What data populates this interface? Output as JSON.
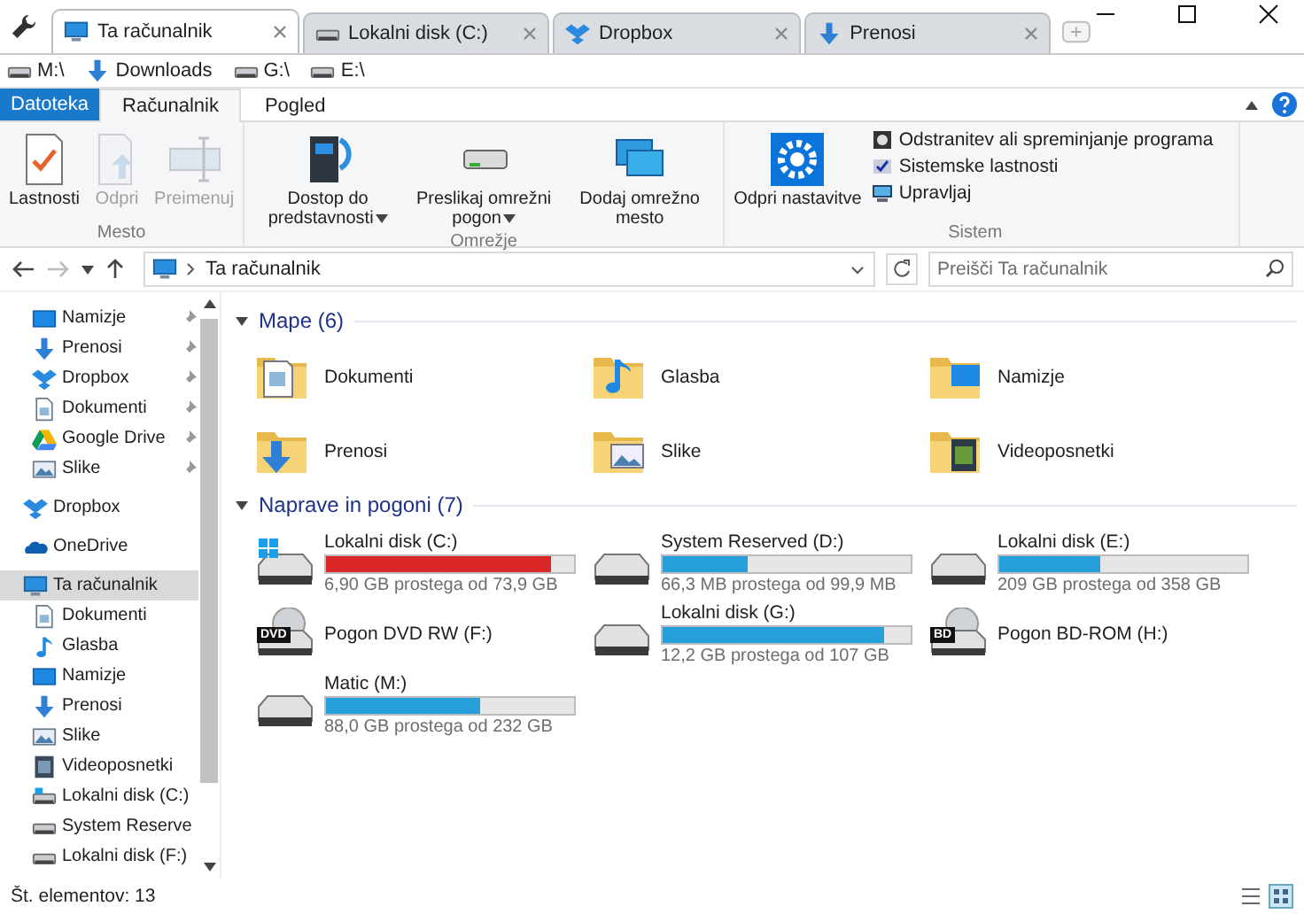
{
  "tabs": [
    {
      "label": "Ta računalnik",
      "selected": true
    },
    {
      "label": "Lokalni disk (C:)",
      "selected": false
    },
    {
      "label": "Dropbox",
      "selected": false
    },
    {
      "label": "Prenosi",
      "selected": false
    }
  ],
  "bookmarks": [
    "M:\\",
    "Downloads",
    "G:\\",
    "E:\\"
  ],
  "ribbon_tabs": [
    {
      "label": "Datoteka",
      "kind": "file"
    },
    {
      "label": "Računalnik",
      "kind": "tab",
      "selected": true
    },
    {
      "label": "Pogled",
      "kind": "tab",
      "selected": false
    }
  ],
  "ribbon_groups": [
    {
      "label": "Mesto",
      "buttons": [
        {
          "label": "Lastnosti",
          "disabled": false
        },
        {
          "label": "Odpri",
          "disabled": true
        },
        {
          "label": "Preimenuj",
          "disabled": true
        }
      ]
    },
    {
      "label": "Omrežje",
      "buttons": [
        {
          "label": "Dostop do predstavnosti",
          "dropdown": true,
          "disabled": false
        },
        {
          "label": "Preslikaj omrežni pogon",
          "dropdown": true,
          "disabled": false
        },
        {
          "label": "Dodaj omrežno mesto",
          "dropdown": false,
          "disabled": false
        }
      ]
    },
    {
      "label": "Sistem",
      "buttons": [
        {
          "label": "Odpri nastavitve",
          "disabled": false
        }
      ],
      "small_buttons": [
        "Odstranitev ali spreminjanje programa",
        "Sistemske lastnosti",
        "Upravljaj"
      ]
    }
  ],
  "address": {
    "path": "Ta računalnik",
    "search_placeholder": "Preišči Ta računalnik"
  },
  "sidebar": {
    "quick_access": [
      {
        "label": "Namizje",
        "pinned": true
      },
      {
        "label": "Prenosi",
        "pinned": true
      },
      {
        "label": "Dropbox",
        "pinned": true
      },
      {
        "label": "Dokumenti",
        "pinned": true
      },
      {
        "label": "Google Drive",
        "pinned": true
      },
      {
        "label": "Slike",
        "pinned": true
      }
    ],
    "items": [
      {
        "label": "Dropbox",
        "selected": false
      },
      {
        "label": "OneDrive",
        "selected": false
      },
      {
        "label": "Ta računalnik",
        "selected": true,
        "children": [
          {
            "label": "Dokumenti"
          },
          {
            "label": "Glasba"
          },
          {
            "label": "Namizje"
          },
          {
            "label": "Prenosi"
          },
          {
            "label": "Slike"
          },
          {
            "label": "Videoposnetki"
          },
          {
            "label": "Lokalni disk (C:)"
          },
          {
            "label": "System Reserve"
          },
          {
            "label": "Lokalni disk (F:)"
          }
        ]
      }
    ]
  },
  "folders": {
    "heading": "Mape (6)",
    "items": [
      "Dokumenti",
      "Glasba",
      "Namizje",
      "Prenosi",
      "Slike",
      "Videoposnetki"
    ]
  },
  "drives": {
    "heading": "Naprave in pogoni (7)",
    "items": [
      {
        "kind": "disk",
        "name": "Lokalni disk (C:)",
        "level": 0.91,
        "critical": true,
        "free": "6,90 GB prostega od 73,9 GB"
      },
      {
        "kind": "disk",
        "name": "System Reserved (D:)",
        "level": 0.34,
        "critical": false,
        "free": "66,3 MB prostega od 99,9 MB"
      },
      {
        "kind": "disk",
        "name": "Lokalni disk (E:)",
        "level": 0.41,
        "critical": false,
        "free": "209 GB prostega od 358 GB"
      },
      {
        "kind": "optical",
        "name": "Pogon DVD RW (F:)",
        "disc_label": "DVD"
      },
      {
        "kind": "disk",
        "name": "Lokalni disk (G:)",
        "level": 0.89,
        "critical": false,
        "free": "12,2 GB prostega od 107 GB"
      },
      {
        "kind": "optical",
        "name": "Pogon BD-ROM (H:)",
        "disc_label": "BD"
      },
      {
        "kind": "disk",
        "name": "Matic (M:)",
        "level": 0.62,
        "critical": false,
        "free": "88,0 GB prostega od 232 GB"
      }
    ]
  },
  "status_bar": "Št. elementov: 13"
}
